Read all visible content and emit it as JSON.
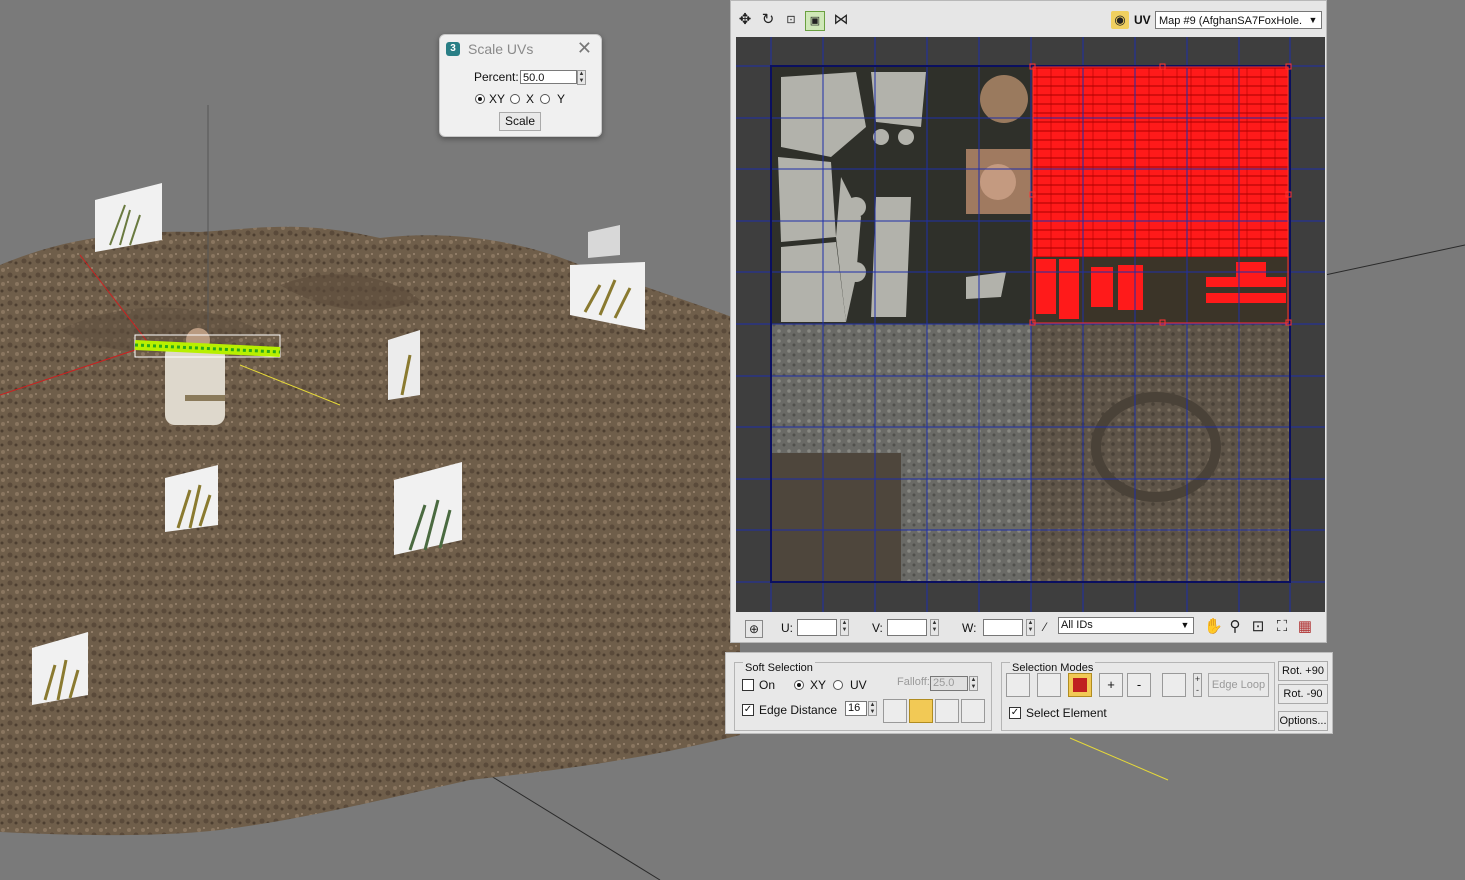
{
  "scale_dialog": {
    "title": "Scale UVs",
    "close": "✕",
    "percent_label": "Percent:",
    "percent_value": "50.0",
    "options": [
      "XY",
      "X",
      "Y"
    ],
    "selected_option": "XY",
    "scale_button": "Scale"
  },
  "uv_editor": {
    "uv_label": "UV",
    "map_select": "Map #9 (AfghanSA7FoxHole.",
    "u_label": "U:",
    "v_label": "V:",
    "w_label": "W:",
    "ids_select": "All IDs"
  },
  "soft_selection": {
    "title": "Soft Selection",
    "on_label": "On",
    "on_checked": false,
    "xy_label": "XY",
    "uv_label": "UV",
    "falloff_label": "Falloff:",
    "falloff_value": "25.0",
    "edge_distance_label": "Edge Distance",
    "edge_distance_checked": true,
    "edge_distance_value": "16"
  },
  "selection_modes": {
    "title": "Selection Modes",
    "plus": "+",
    "minus": "-",
    "edge_loop": "Edge Loop",
    "select_element_label": "Select Element",
    "select_element_checked": true
  },
  "rotate": {
    "rot_plus": "Rot. +90",
    "rot_minus": "Rot. -90",
    "options": "Options..."
  },
  "colors": {
    "uv_grid": "#1f2fa8",
    "selection": "#ff1a1a",
    "viewport_bg": "#7a7a7a"
  },
  "icons": [
    "move-icon",
    "rotate-icon",
    "scale-icon",
    "freeform-icon",
    "mirror-icon",
    "texture-icon",
    "pan-icon",
    "zoom-icon",
    "zoom-region-icon",
    "zoom-extents-icon",
    "grid-snap-icon"
  ]
}
